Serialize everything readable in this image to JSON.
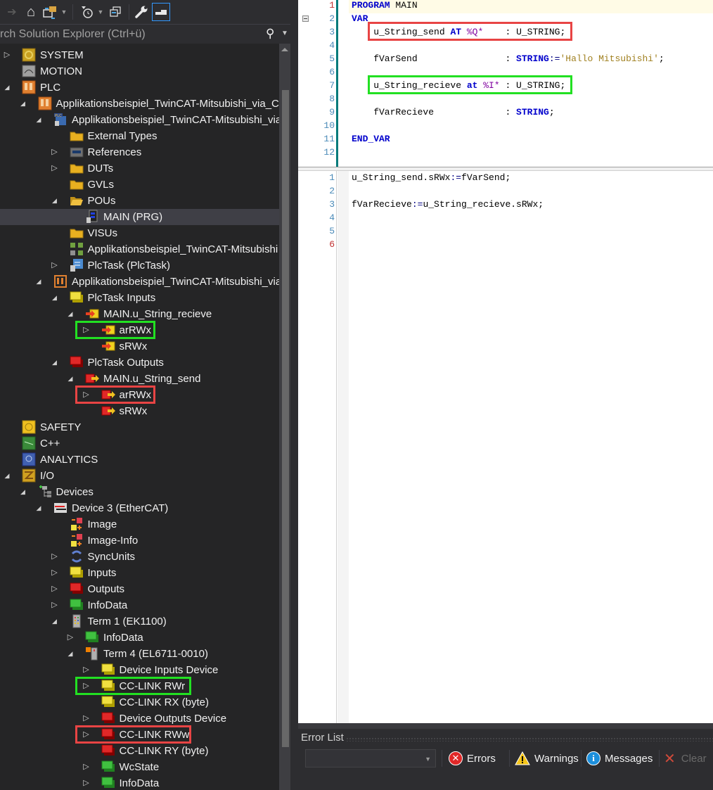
{
  "toolbar": {
    "buttons": [
      {
        "name": "forward",
        "glyph": "➔"
      },
      {
        "name": "home",
        "glyph": "⌂"
      },
      {
        "name": "sync-with-active",
        "glyph": "⇄"
      },
      {
        "name": "pending-changes",
        "glyph": "◷"
      },
      {
        "name": "collapse-all",
        "glyph": "❐"
      },
      {
        "name": "properties",
        "glyph": "🔧"
      },
      {
        "name": "preview",
        "glyph": "▬"
      }
    ]
  },
  "search": {
    "placeholder": "rch Solution Explorer (Ctrl+ü)"
  },
  "tree": [
    {
      "label": "SYSTEM",
      "indent": 0,
      "expander": "collapsed",
      "icon": "system"
    },
    {
      "label": "MOTION",
      "indent": 0,
      "expander": "none",
      "icon": "motion"
    },
    {
      "label": "PLC",
      "indent": 0,
      "expander": "expanded",
      "icon": "plc"
    },
    {
      "label": "Applikationsbeispiel_TwinCAT-Mitsubishi_via_CC",
      "indent": 1,
      "expander": "expanded",
      "icon": "plc-project"
    },
    {
      "label": "Applikationsbeispiel_TwinCAT-Mitsubishi_via",
      "indent": 2,
      "expander": "expanded",
      "icon": "plc-subproject"
    },
    {
      "label": "External Types",
      "indent": 3,
      "expander": "none",
      "icon": "folder"
    },
    {
      "label": "References",
      "indent": 3,
      "expander": "collapsed",
      "icon": "references"
    },
    {
      "label": "DUTs",
      "indent": 3,
      "expander": "collapsed",
      "icon": "folder"
    },
    {
      "label": "GVLs",
      "indent": 3,
      "expander": "none",
      "icon": "folder"
    },
    {
      "label": "POUs",
      "indent": 3,
      "expander": "expanded",
      "icon": "folder-open"
    },
    {
      "label": "MAIN (PRG)",
      "indent": 4,
      "expander": "none",
      "icon": "program",
      "selected": true
    },
    {
      "label": "VISUs",
      "indent": 3,
      "expander": "none",
      "icon": "folder"
    },
    {
      "label": "Applikationsbeispiel_TwinCAT-Mitsubishi",
      "indent": 3,
      "expander": "none",
      "icon": "tmc"
    },
    {
      "label": "PlcTask (PlcTask)",
      "indent": 3,
      "expander": "collapsed",
      "icon": "task"
    },
    {
      "label": "Applikationsbeispiel_TwinCAT-Mitsubishi_via",
      "indent": 2,
      "expander": "expanded",
      "icon": "plc-instance"
    },
    {
      "label": "PlcTask Inputs",
      "indent": 3,
      "expander": "expanded",
      "icon": "inputs"
    },
    {
      "label": "MAIN.u_String_recieve",
      "indent": 4,
      "expander": "expanded",
      "icon": "input-var"
    },
    {
      "label": "arRWx",
      "indent": 5,
      "expander": "collapsed",
      "icon": "input-var",
      "highlight": "green"
    },
    {
      "label": "sRWx",
      "indent": 5,
      "expander": "none",
      "icon": "input-var"
    },
    {
      "label": "PlcTask Outputs",
      "indent": 3,
      "expander": "expanded",
      "icon": "outputs"
    },
    {
      "label": "MAIN.u_String_send",
      "indent": 4,
      "expander": "expanded",
      "icon": "output-var"
    },
    {
      "label": "arRWx",
      "indent": 5,
      "expander": "collapsed",
      "icon": "output-var",
      "highlight": "red"
    },
    {
      "label": "sRWx",
      "indent": 5,
      "expander": "none",
      "icon": "output-var"
    },
    {
      "label": "SAFETY",
      "indent": 0,
      "expander": "none",
      "icon": "safety"
    },
    {
      "label": "C++",
      "indent": 0,
      "expander": "none",
      "icon": "cpp"
    },
    {
      "label": "ANALYTICS",
      "indent": 0,
      "expander": "none",
      "icon": "analytics"
    },
    {
      "label": "I/O",
      "indent": 0,
      "expander": "expanded",
      "icon": "io"
    },
    {
      "label": "Devices",
      "indent": 1,
      "expander": "expanded",
      "icon": "devices"
    },
    {
      "label": "Device 3 (EtherCAT)",
      "indent": 2,
      "expander": "expanded",
      "icon": "ethercat"
    },
    {
      "label": "Image",
      "indent": 3,
      "expander": "none",
      "icon": "image"
    },
    {
      "label": "Image-Info",
      "indent": 3,
      "expander": "none",
      "icon": "image"
    },
    {
      "label": "SyncUnits",
      "indent": 3,
      "expander": "collapsed",
      "icon": "sync"
    },
    {
      "label": "Inputs",
      "indent": 3,
      "expander": "collapsed",
      "icon": "inputs"
    },
    {
      "label": "Outputs",
      "indent": 3,
      "expander": "collapsed",
      "icon": "outputs"
    },
    {
      "label": "InfoData",
      "indent": 3,
      "expander": "collapsed",
      "icon": "infodata"
    },
    {
      "label": "Term 1 (EK1100)",
      "indent": 3,
      "expander": "expanded",
      "icon": "terminal"
    },
    {
      "label": "InfoData",
      "indent": 4,
      "expander": "collapsed",
      "icon": "infodata"
    },
    {
      "label": "Term 4 (EL6711-0010)",
      "indent": 4,
      "expander": "expanded",
      "icon": "terminal-orange"
    },
    {
      "label": "Device Inputs Device",
      "indent": 5,
      "expander": "collapsed",
      "icon": "inputs"
    },
    {
      "label": "CC-LINK RWr",
      "indent": 5,
      "expander": "collapsed",
      "icon": "inputs",
      "highlight": "green"
    },
    {
      "label": "CC-LINK RX (byte)",
      "indent": 5,
      "expander": "none",
      "icon": "inputs"
    },
    {
      "label": "Device Outputs Device",
      "indent": 5,
      "expander": "collapsed",
      "icon": "outputs"
    },
    {
      "label": "CC-LINK RWw",
      "indent": 5,
      "expander": "collapsed",
      "icon": "outputs",
      "highlight": "red"
    },
    {
      "label": "CC-LINK RY (byte)",
      "indent": 5,
      "expander": "none",
      "icon": "outputs"
    },
    {
      "label": "WcState",
      "indent": 5,
      "expander": "collapsed",
      "icon": "infodata"
    },
    {
      "label": "InfoData",
      "indent": 5,
      "expander": "collapsed",
      "icon": "infodata"
    }
  ],
  "editor": {
    "declaration": {
      "line_numbers": [
        "1",
        "2",
        "3",
        "4",
        "5",
        "6",
        "7",
        "8",
        "9",
        "10",
        "11",
        "12"
      ],
      "current_line": 1,
      "lines": [
        [
          {
            "t": "PROGRAM",
            "c": "kw"
          },
          {
            "t": " MAIN",
            "c": ""
          }
        ],
        [
          {
            "t": "VAR",
            "c": "kw"
          }
        ],
        [
          {
            "t": "    u_String_send ",
            "c": ""
          },
          {
            "t": "AT",
            "c": "kw"
          },
          {
            "t": " %Q*",
            "c": "at"
          },
          {
            "t": "    : U_STRING;",
            "c": ""
          }
        ],
        [],
        [
          {
            "t": "    fVarSend                ",
            "c": ""
          },
          {
            "t": ": ",
            "c": ""
          },
          {
            "t": "STRING",
            "c": "kw"
          },
          {
            "t": ":=",
            "c": "op"
          },
          {
            "t": "'Hallo Mitsubishi'",
            "c": "str"
          },
          {
            "t": ";",
            "c": ""
          }
        ],
        [],
        [
          {
            "t": "    u_String_recieve ",
            "c": ""
          },
          {
            "t": "at",
            "c": "kw"
          },
          {
            "t": " %I*",
            "c": "at"
          },
          {
            "t": " : U_STRING;",
            "c": ""
          }
        ],
        [],
        [
          {
            "t": "    fVarRecieve             ",
            "c": ""
          },
          {
            "t": ": ",
            "c": ""
          },
          {
            "t": "STRING",
            "c": "kw"
          },
          {
            "t": ";",
            "c": ""
          }
        ],
        [],
        [
          {
            "t": "END_VAR",
            "c": "kw"
          }
        ],
        []
      ],
      "highlights": [
        {
          "line": 3,
          "color": "red"
        },
        {
          "line": 7,
          "color": "green"
        }
      ]
    },
    "implementation": {
      "line_numbers": [
        "1",
        "2",
        "3",
        "4",
        "5",
        "6"
      ],
      "current_line": 6,
      "lines": [
        [
          {
            "t": "u_String_send.sRWx",
            "c": ""
          },
          {
            "t": ":=",
            "c": "op"
          },
          {
            "t": "fVarSend;",
            "c": ""
          }
        ],
        [],
        [
          {
            "t": "fVarRecieve",
            "c": ""
          },
          {
            "t": ":=",
            "c": "op"
          },
          {
            "t": "u_String_recieve.sRWx;",
            "c": ""
          }
        ],
        [],
        [],
        []
      ]
    }
  },
  "error_list": {
    "title": "Error List",
    "filter_value": "",
    "errors_label": "Errors",
    "warnings_label": "Warnings",
    "messages_label": "Messages",
    "clear_label": "Clear"
  },
  "colors": {
    "highlight_green": "#22e022",
    "highlight_red": "#e84444"
  }
}
